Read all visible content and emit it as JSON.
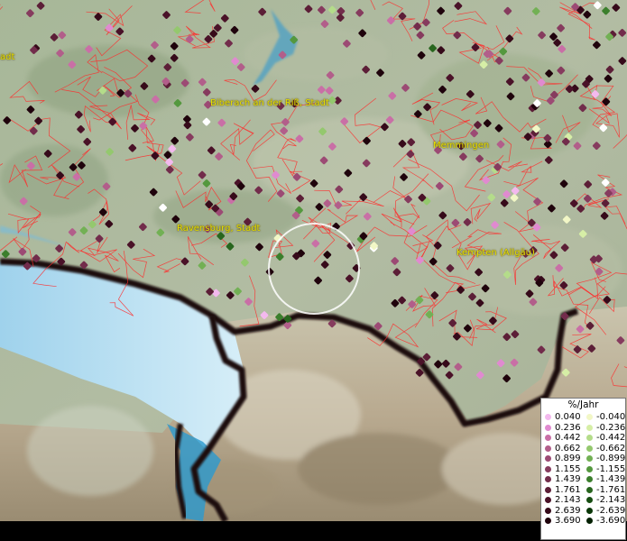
{
  "map": {
    "cities": [
      {
        "id": "city-biberach",
        "label": "Biberach an der Riß, Stadt"
      },
      {
        "id": "city-memmingen",
        "label": "Memmingen"
      },
      {
        "id": "city-ravensburg",
        "label": "Ravensburg, Stadt"
      },
      {
        "id": "city-kempten",
        "label": "Kempten (Allgäu)"
      },
      {
        "id": "city-partial-left",
        "label": "adt"
      }
    ],
    "colors": {
      "land": "#a9b79c",
      "lake": "#bfe3f2",
      "border": "#ff2a2a",
      "coast": "#1a0a10",
      "label": "#e8e000"
    }
  },
  "legend": {
    "title": "%/Jahr",
    "positive": [
      {
        "value": "0.040",
        "color": "#f3b9ee"
      },
      {
        "value": "0.236",
        "color": "#e08ad0"
      },
      {
        "value": "0.442",
        "color": "#c96fa6"
      },
      {
        "value": "0.662",
        "color": "#b25e8a"
      },
      {
        "value": "0.899",
        "color": "#9c4a74"
      },
      {
        "value": "1.155",
        "color": "#863b5e"
      },
      {
        "value": "1.439",
        "color": "#722c4b"
      },
      {
        "value": "1.761",
        "color": "#5c1e37"
      },
      {
        "value": "2.143",
        "color": "#4a1228"
      },
      {
        "value": "2.639",
        "color": "#360a1a"
      },
      {
        "value": "3.690",
        "color": "#1f030c"
      }
    ],
    "negative": [
      {
        "value": "-0.040",
        "color": "#f2f7c6"
      },
      {
        "value": "-0.236",
        "color": "#d6eea6"
      },
      {
        "value": "-0.442",
        "color": "#b4dc8a"
      },
      {
        "value": "-0.662",
        "color": "#94c86e"
      },
      {
        "value": "-0.899",
        "color": "#72b054"
      },
      {
        "value": "-1.155",
        "color": "#54983e"
      },
      {
        "value": "-1.439",
        "color": "#3b7f2c"
      },
      {
        "value": "-1.761",
        "color": "#28661e"
      },
      {
        "value": "-2.143",
        "color": "#174e12"
      },
      {
        "value": "-2.639",
        "color": "#0a3808"
      },
      {
        "value": "-3.690",
        "color": "#032002"
      }
    ]
  }
}
